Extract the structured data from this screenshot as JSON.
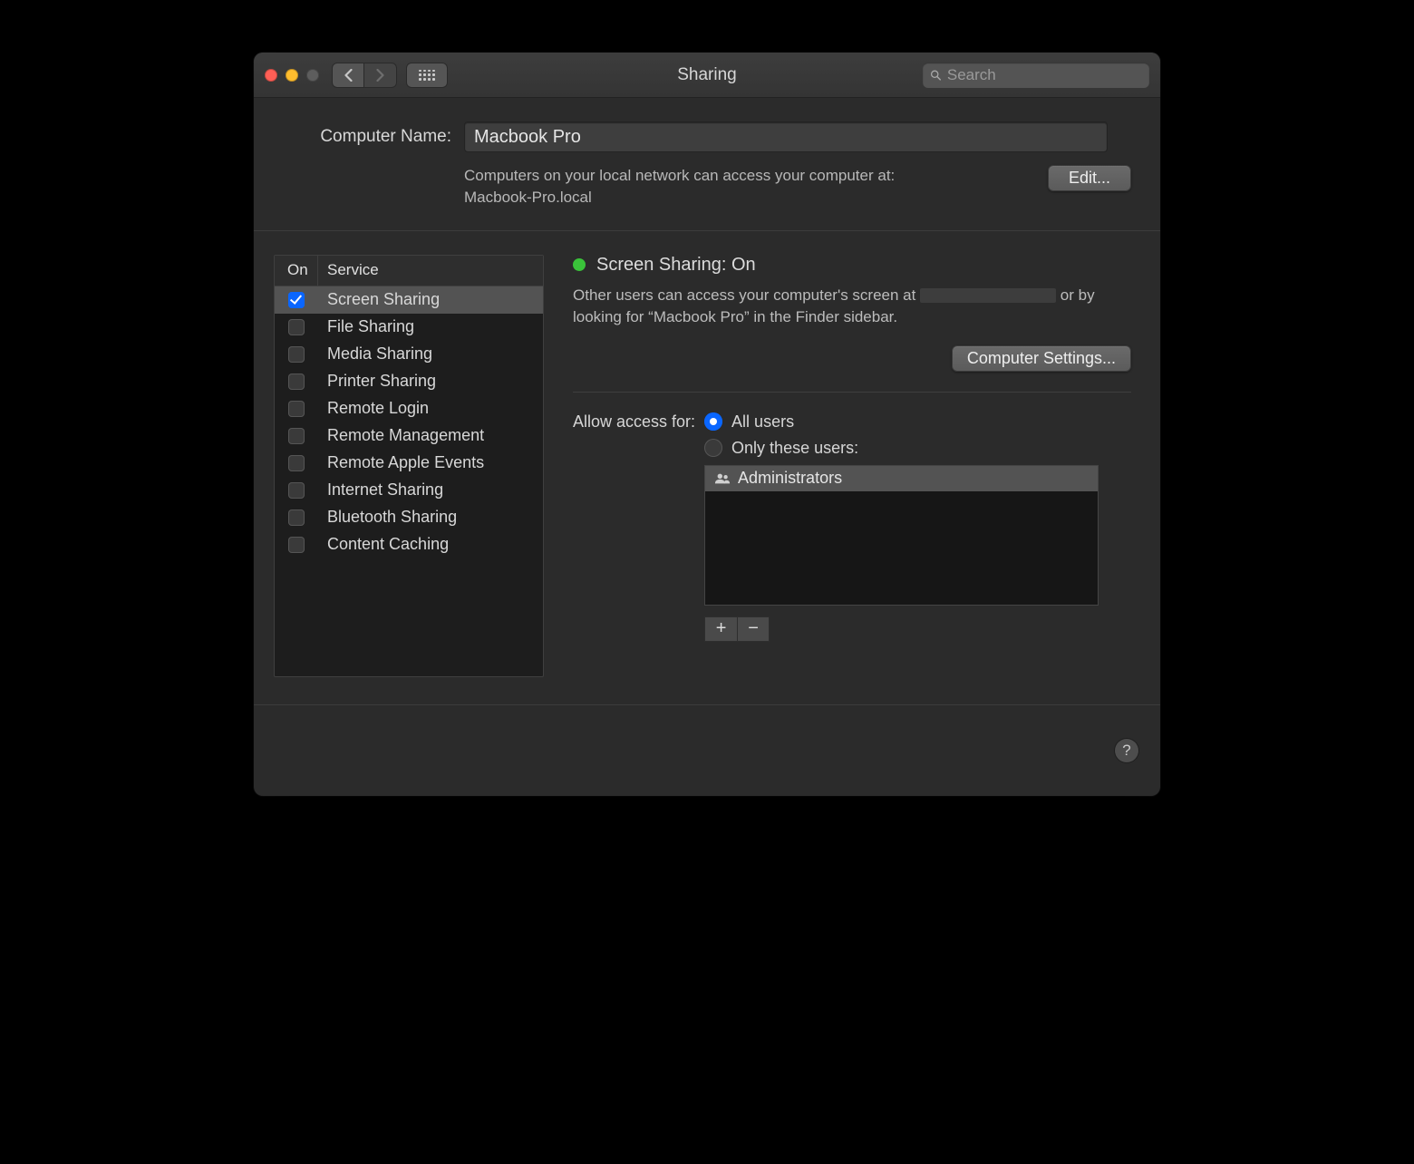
{
  "window": {
    "title": "Sharing",
    "search_placeholder": "Search"
  },
  "computer_name": {
    "label": "Computer Name:",
    "value": "Macbook Pro",
    "hint_line1": "Computers on your local network can access your computer at:",
    "hint_line2": "Macbook-Pro.local",
    "edit_label": "Edit..."
  },
  "services": {
    "col_on": "On",
    "col_service": "Service",
    "items": [
      {
        "label": "Screen Sharing",
        "on": true,
        "selected": true
      },
      {
        "label": "File Sharing",
        "on": false,
        "selected": false
      },
      {
        "label": "Media Sharing",
        "on": false,
        "selected": false
      },
      {
        "label": "Printer Sharing",
        "on": false,
        "selected": false
      },
      {
        "label": "Remote Login",
        "on": false,
        "selected": false
      },
      {
        "label": "Remote Management",
        "on": false,
        "selected": false
      },
      {
        "label": "Remote Apple Events",
        "on": false,
        "selected": false
      },
      {
        "label": "Internet Sharing",
        "on": false,
        "selected": false
      },
      {
        "label": "Bluetooth Sharing",
        "on": false,
        "selected": false
      },
      {
        "label": "Content Caching",
        "on": false,
        "selected": false
      }
    ]
  },
  "detail": {
    "status_title": "Screen Sharing: On",
    "desc_prefix": "Other users can access your computer's screen at ",
    "desc_suffix": " or by looking for “Macbook Pro” in the Finder sidebar.",
    "computer_settings_label": "Computer Settings...",
    "access_label": "Allow access for:",
    "radio_all": "All users",
    "radio_only": "Only these users:",
    "users": [
      "Administrators"
    ]
  },
  "help_label": "?"
}
